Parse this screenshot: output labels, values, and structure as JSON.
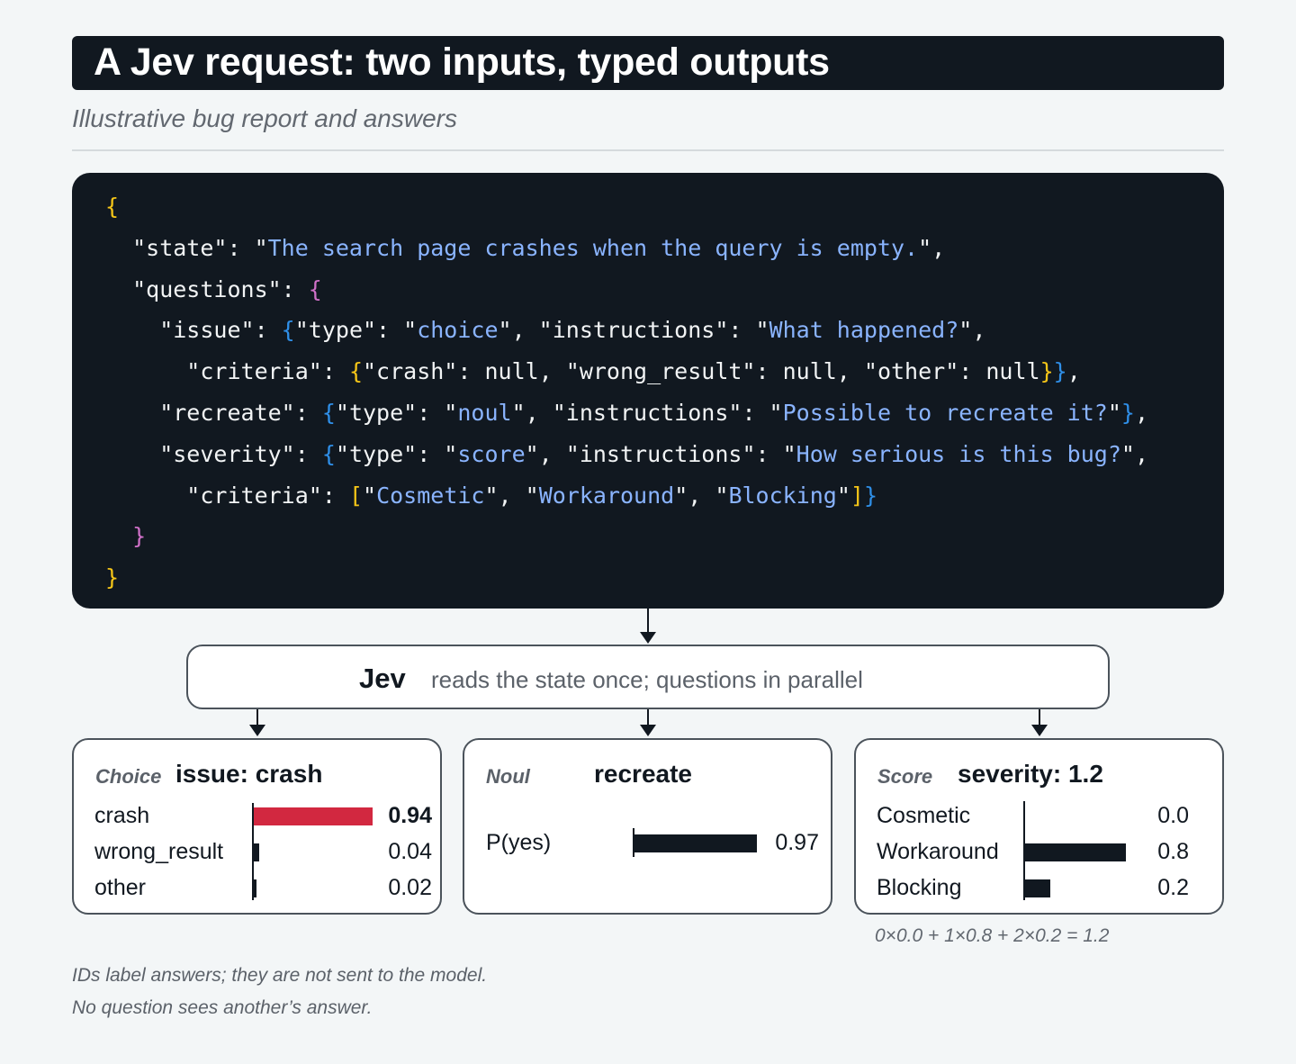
{
  "header": {
    "title": "A Jev request: two inputs, typed outputs",
    "subtitle": "Illustrative bug report and answers"
  },
  "code": {
    "lines": [
      [
        [
          "{",
          "y"
        ]
      ],
      [
        [
          "  \"state\": \"",
          "k"
        ],
        [
          "The search page crashes when the query is empty.",
          "s"
        ],
        [
          "\",",
          "k"
        ]
      ],
      [
        [
          "  \"questions\": ",
          "k"
        ],
        [
          "{",
          "p"
        ]
      ],
      [
        [
          "    \"issue\": ",
          "k"
        ],
        [
          "{",
          "b"
        ],
        [
          "\"type\": \"",
          "k"
        ],
        [
          "choice",
          "s"
        ],
        [
          "\", \"instructions\": \"",
          "k"
        ],
        [
          "What happened?",
          "s"
        ],
        [
          "\",",
          "k"
        ]
      ],
      [
        [
          "      \"criteria\": ",
          "k"
        ],
        [
          "{",
          "y"
        ],
        [
          "\"crash\": null, \"wrong_result\": null, \"other\": null",
          "k"
        ],
        [
          "}",
          "y"
        ],
        [
          "}",
          "b"
        ],
        [
          ",",
          "k"
        ]
      ],
      [
        [
          "    \"recreate\": ",
          "k"
        ],
        [
          "{",
          "b"
        ],
        [
          "\"type\": \"",
          "k"
        ],
        [
          "noul",
          "s"
        ],
        [
          "\", \"instructions\": \"",
          "k"
        ],
        [
          "Possible to recreate it?",
          "s"
        ],
        [
          "\"",
          "k"
        ],
        [
          "}",
          "b"
        ],
        [
          ",",
          "k"
        ]
      ],
      [
        [
          "    \"severity\": ",
          "k"
        ],
        [
          "{",
          "b"
        ],
        [
          "\"type\": \"",
          "k"
        ],
        [
          "score",
          "s"
        ],
        [
          "\", \"instructions\": \"",
          "k"
        ],
        [
          "How serious is this bug?",
          "s"
        ],
        [
          "\",",
          "k"
        ]
      ],
      [
        [
          "      \"criteria\": ",
          "k"
        ],
        [
          "[",
          "y"
        ],
        [
          "\"",
          "k"
        ],
        [
          "Cosmetic",
          "s"
        ],
        [
          "\", \"",
          "k"
        ],
        [
          "Workaround",
          "s"
        ],
        [
          "\", \"",
          "k"
        ],
        [
          "Blocking",
          "s"
        ],
        [
          "\"",
          "k"
        ],
        [
          "]",
          "y"
        ],
        [
          "}",
          "b"
        ]
      ],
      [
        [
          "  }",
          "p"
        ]
      ],
      [
        [
          "}",
          "y"
        ]
      ]
    ]
  },
  "jev": {
    "name": "Jev",
    "description": "reads the state once; questions in parallel"
  },
  "cards": {
    "choice": {
      "type": "Choice",
      "title": "issue: crash",
      "rows": [
        {
          "label": "crash",
          "value": 0.94,
          "display": "0.94",
          "bold": true,
          "accent": true
        },
        {
          "label": "wrong_result",
          "value": 0.04,
          "display": "0.04",
          "bold": false,
          "accent": false
        },
        {
          "label": "other",
          "value": 0.02,
          "display": "0.02",
          "bold": false,
          "accent": false
        }
      ]
    },
    "noul": {
      "type": "Noul",
      "title": "recreate",
      "rows": [
        {
          "label": "P(yes)",
          "value": 0.97,
          "display": "0.97"
        }
      ]
    },
    "score": {
      "type": "Score",
      "title": "severity: 1.2",
      "rows": [
        {
          "label": "Cosmetic",
          "value": 0.0,
          "display": "0.0"
        },
        {
          "label": "Workaround",
          "value": 0.8,
          "display": "0.8"
        },
        {
          "label": "Blocking",
          "value": 0.2,
          "display": "0.2"
        }
      ],
      "formula": "0×0.0 + 1×0.8 + 2×0.2 = 1.2"
    }
  },
  "footnotes": [
    "IDs label answers; they are not sent to the model.",
    "No question sees another’s answer."
  ],
  "colors": {
    "dark": "#111820",
    "accent": "#d22840",
    "string": "#8ab4ff",
    "bracket_yellow": "#f5c518",
    "bracket_pink": "#d070c8",
    "bracket_blue": "#2f8fe8"
  }
}
